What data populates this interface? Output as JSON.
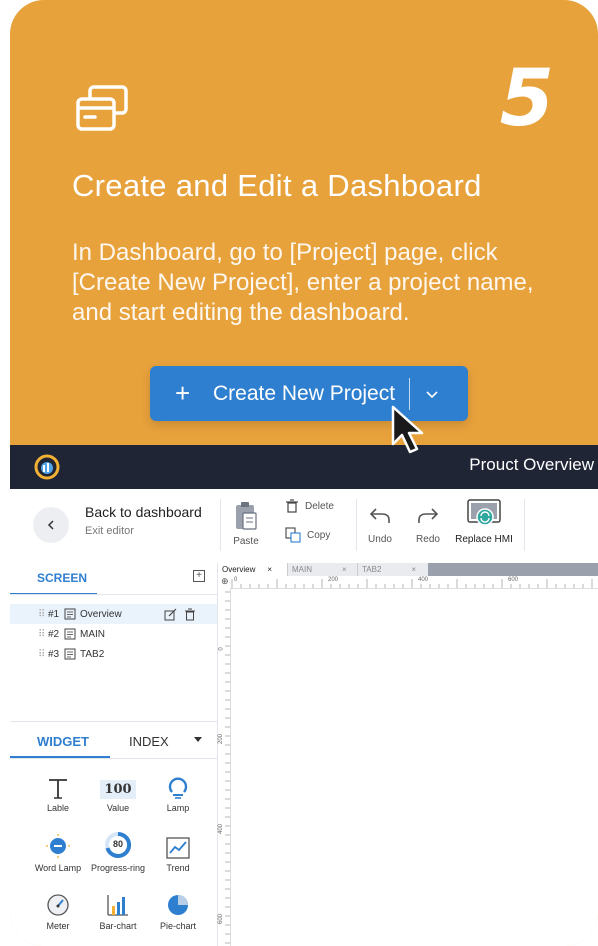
{
  "card": {
    "step_number": "5",
    "title": "Create and Edit a Dashboard",
    "description": "In Dashboard, go to [Project] page, click [Create New Project], enter a project name, and start editing the dashboard.",
    "button_plus": "+",
    "button_label": "Create New Project",
    "bg_color": "#E8A23C",
    "button_color": "#2F7FD0",
    "icon": "window-cards-icon"
  },
  "app": {
    "header_title": "Prouct Overview",
    "back_title": "Back to dashboard",
    "back_subtitle": "Exit editor",
    "tools": {
      "paste": "Paste",
      "delete": "Delete",
      "copy": "Copy",
      "undo": "Undo",
      "redo": "Redo",
      "replace_hmi": "Replace HMI"
    },
    "screen_panel": {
      "tab_label": "SCREEN",
      "add_symbol": "+",
      "items": [
        {
          "num": "#1",
          "label": "Overview"
        },
        {
          "num": "#2",
          "label": "MAIN"
        },
        {
          "num": "#3",
          "label": "TAB2"
        }
      ]
    },
    "widget_panel": {
      "tab_widget": "WIDGET",
      "tab_index": "INDEX",
      "value_sample": "100",
      "progress_sample": "80",
      "widgets": [
        "Lable",
        "Value",
        "Lamp",
        "Word Lamp",
        "Progress-ring",
        "Trend",
        "Meter",
        "Bar-chart",
        "Pie-chart"
      ]
    },
    "canvas": {
      "tabs": [
        {
          "label": "Overview",
          "close": "×"
        },
        {
          "label": "MAIN",
          "close": "×"
        },
        {
          "label": "TAB2",
          "close": "×"
        }
      ],
      "ruler_h": [
        "0",
        "200",
        "400",
        "600"
      ],
      "ruler_v": [
        "0",
        "200",
        "400",
        "600"
      ]
    }
  }
}
